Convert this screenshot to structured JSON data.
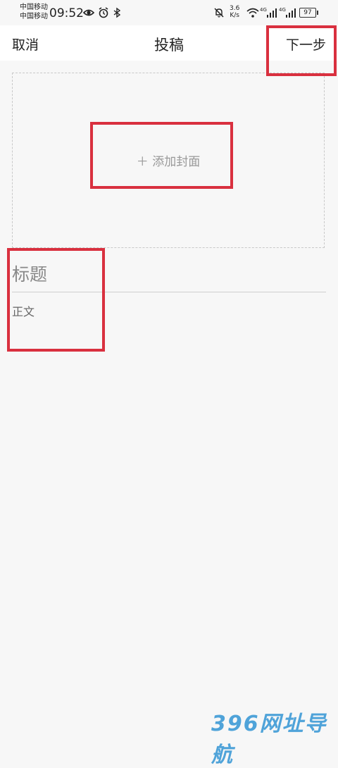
{
  "status_bar": {
    "carrier1": "中国移动",
    "carrier2": "中国移动",
    "time": "09:52",
    "net_speed_value": "3.6",
    "net_speed_unit": "K/s",
    "net_type1": "4G",
    "net_type2": "4G",
    "battery": "97"
  },
  "topbar": {
    "cancel_label": "取消",
    "title": "投稿",
    "next_label": "下一步"
  },
  "cover": {
    "add_label": "＋ 添加封面"
  },
  "editor": {
    "title_placeholder": "标题",
    "body_placeholder": "正文"
  },
  "watermark": "396网址导航",
  "colors": {
    "highlight": "#d9303f",
    "background": "#f7f7f7"
  }
}
